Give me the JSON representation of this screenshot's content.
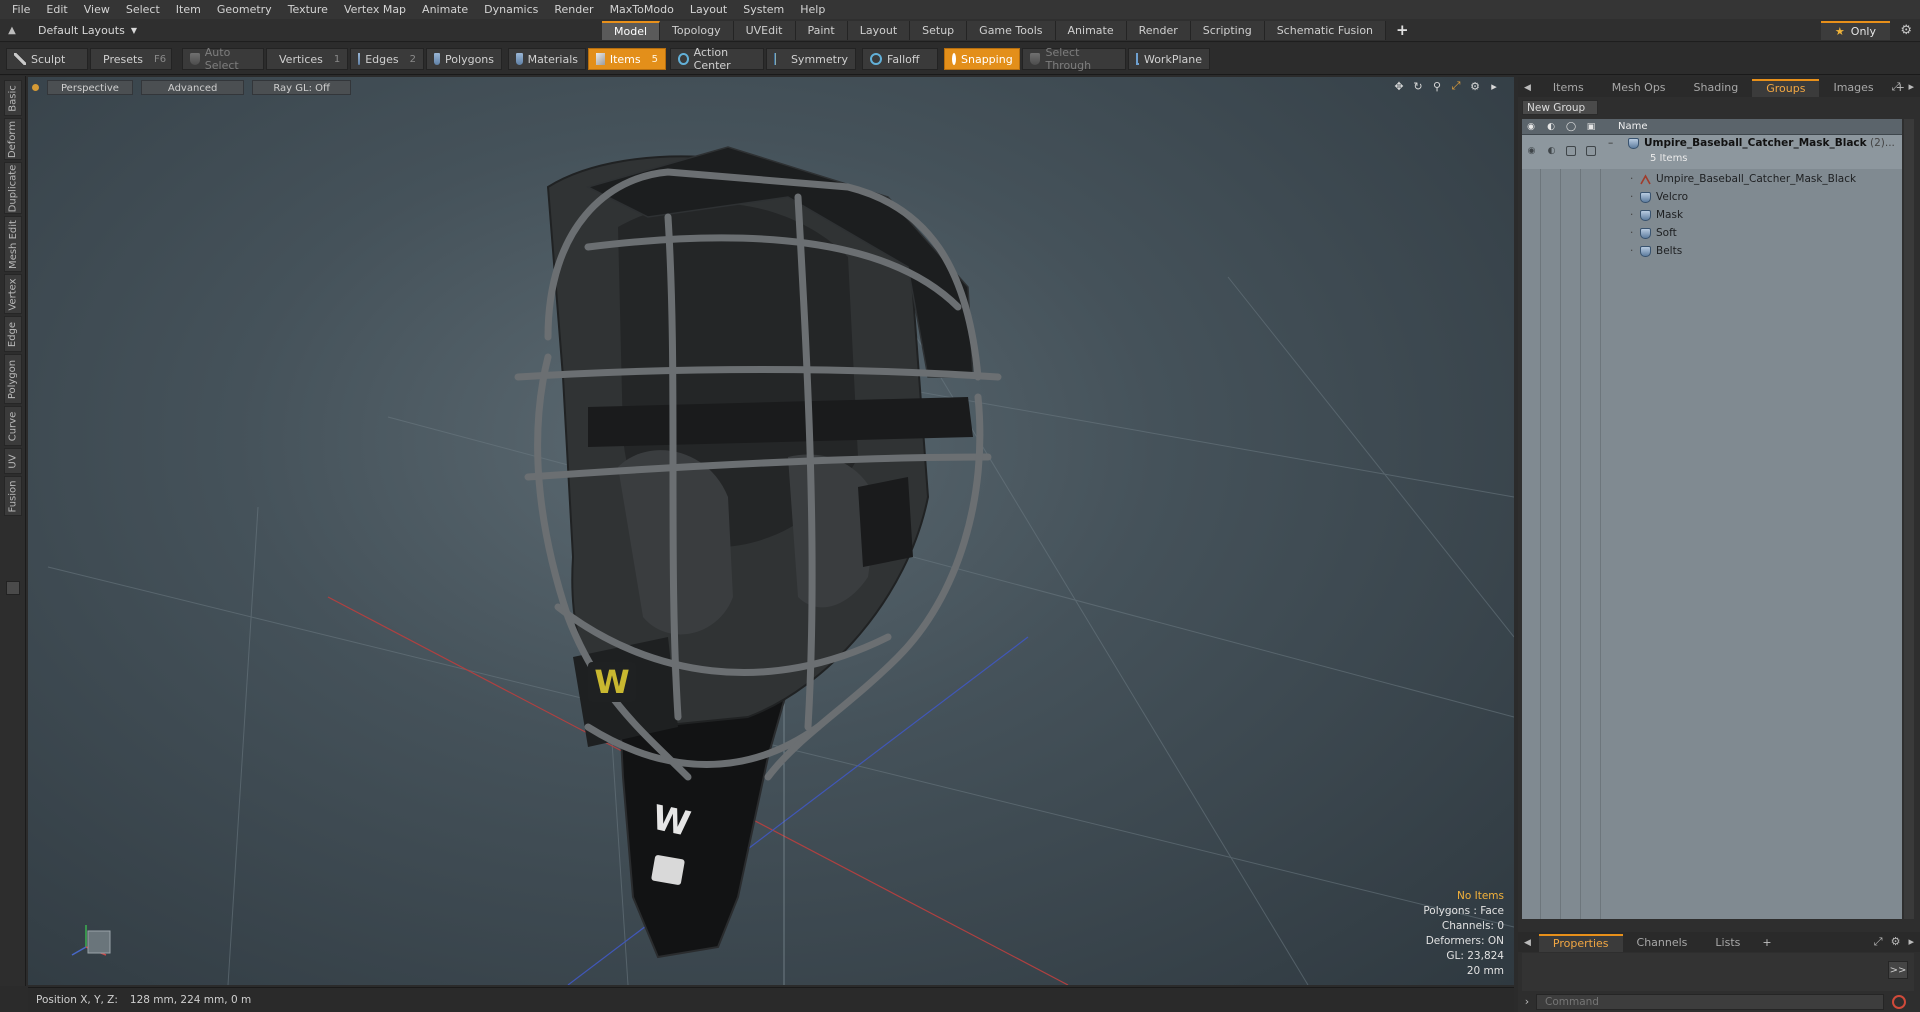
{
  "menubar": {
    "items": [
      "File",
      "Edit",
      "View",
      "Select",
      "Item",
      "Geometry",
      "Texture",
      "Vertex Map",
      "Animate",
      "Dynamics",
      "Render",
      "MaxToModo",
      "Layout",
      "System",
      "Help"
    ]
  },
  "layout_selector": {
    "label": "Default Layouts"
  },
  "mode_tabs": {
    "items": [
      "Model",
      "Topology",
      "UVEdit",
      "Paint",
      "Layout",
      "Setup",
      "Game Tools",
      "Animate",
      "Render",
      "Scripting",
      "Schematic Fusion"
    ],
    "active": "Model",
    "add_label": "+"
  },
  "only_toggle": {
    "label": "Only"
  },
  "toolbar": {
    "sculpt": "Sculpt",
    "presets": "Presets",
    "presets_key": "F6",
    "auto_select": "Auto Select",
    "vertices": "Vertices",
    "vertices_count": "1",
    "edges": "Edges",
    "edges_count": "2",
    "polygons": "Polygons",
    "materials": "Materials",
    "items": "Items",
    "items_count": "5",
    "action_center": "Action Center",
    "symmetry": "Symmetry",
    "falloff": "Falloff",
    "snapping": "Snapping",
    "select_through": "Select Through",
    "workplane": "WorkPlane"
  },
  "left_tabs": [
    "Basic",
    "Deform",
    "Duplicate",
    "Mesh Edit",
    "Vertex",
    "Edge",
    "Polygon",
    "Curve",
    "UV",
    "Fusion"
  ],
  "viewport": {
    "view_mode": "Perspective",
    "shading": "Advanced",
    "raygl": "Ray GL: Off",
    "info": {
      "selection": "No Items",
      "polygons": "Polygons : Face",
      "channels": "Channels: 0",
      "deformers": "Deformers: ON",
      "gl": "GL: 23,824",
      "scale": "20 mm"
    },
    "logo_letter": "W"
  },
  "status": {
    "label": "Position X, Y, Z:",
    "value": "128 mm, 224 mm, 0 m"
  },
  "right_panel": {
    "tabs": [
      "Items",
      "Mesh Ops",
      "Shading",
      "Groups",
      "Images"
    ],
    "active_tab": "Groups",
    "new_group": "New Group",
    "column_name": "Name",
    "group": {
      "name": "Umpire_Baseball_Catcher_Mask_Black",
      "count_suffix": "(2)...",
      "items_label": "5 Items",
      "children": [
        "Umpire_Baseball_Catcher_Mask_Black",
        "Velcro",
        "Mask",
        "Soft",
        "Belts"
      ]
    },
    "bottom_tabs": [
      "Properties",
      "Channels",
      "Lists"
    ],
    "bottom_active": "Properties",
    "arrow_label": ">>",
    "command_placeholder": "Command"
  },
  "colors": {
    "accent": "#e8901a",
    "viewport_bg": "#4a5760",
    "panel_list_bg": "#808a91"
  }
}
